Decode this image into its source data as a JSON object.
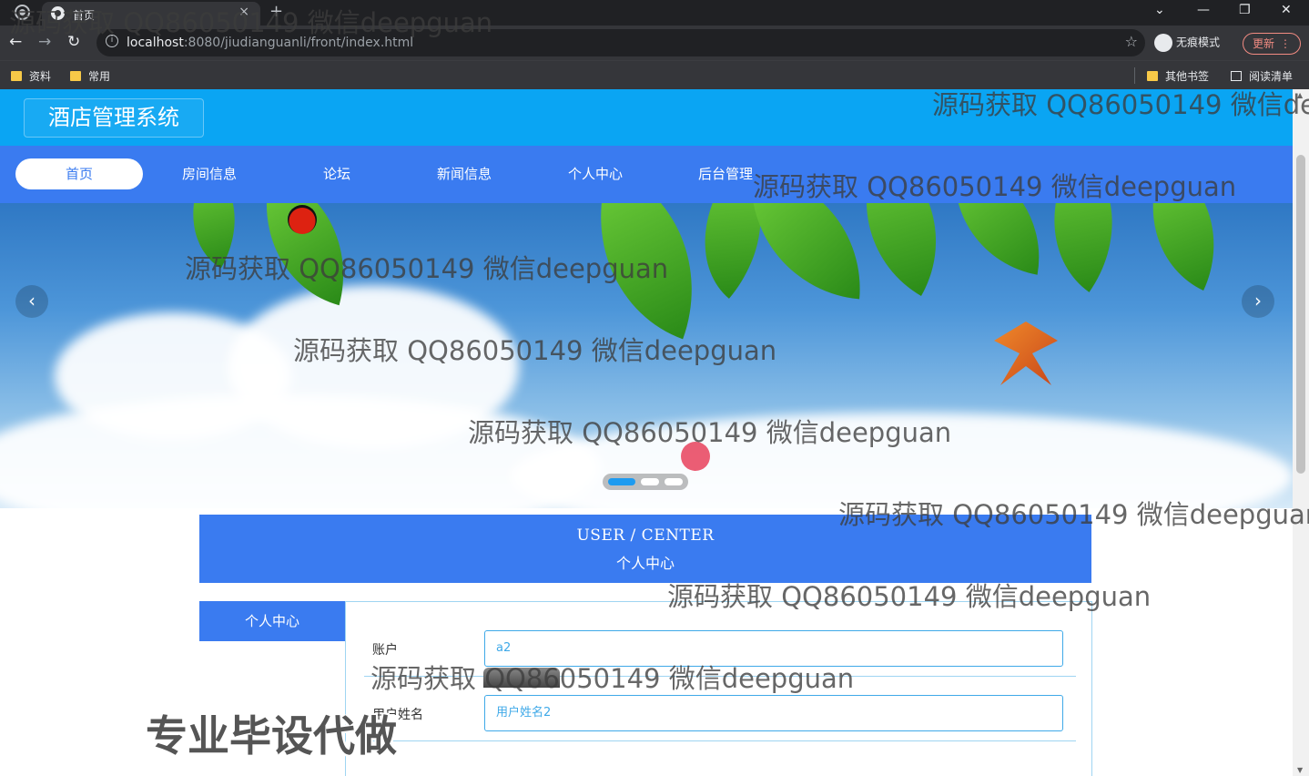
{
  "browser": {
    "tab_title": "首页",
    "tab_close": "×",
    "new_tab": "+",
    "url_host": "localhost",
    "url_rest": ":8080/jiudianguanli/front/index.html",
    "incognito_label": "无痕模式",
    "update_label": "更新",
    "update_menu": "⋮",
    "bookmarks": [
      {
        "label": "资料"
      },
      {
        "label": "常用"
      }
    ],
    "other_bookmarks": "其他书签",
    "reading_list": "阅读清单",
    "back_icon": "←",
    "forward_icon": "→",
    "reload_icon": "↻",
    "star_icon": "☆",
    "info_icon": "i",
    "win_dropdown": "⌄",
    "win_minimize": "—",
    "win_restore": "❐",
    "win_close": "✕"
  },
  "site": {
    "title": "酒店管理系统",
    "nav": [
      {
        "label": "首页",
        "active": true
      },
      {
        "label": "房间信息",
        "active": false
      },
      {
        "label": "论坛",
        "active": false
      },
      {
        "label": "新闻信息",
        "active": false
      },
      {
        "label": "个人中心",
        "active": false
      },
      {
        "label": "后台管理",
        "active": false
      }
    ],
    "carousel": {
      "prev_icon": "‹",
      "next_icon": "›",
      "slide_count": 3,
      "active_index": 0
    },
    "user_center": {
      "title_en": "USER / CENTER",
      "title_zh": "个人中心",
      "side_menu": "个人中心",
      "fields": [
        {
          "label": "账户",
          "value": "a2"
        },
        {
          "label": "用户姓名",
          "value": "用户姓名2"
        }
      ]
    }
  },
  "watermark": {
    "text": "源码获取 QQ86050149 微信deepguan",
    "big": "专业毕设代做"
  },
  "colors": {
    "header_bg": "#0aa5f3",
    "nav_bg": "#3a7bf0",
    "input_border": "#3fa9e8"
  }
}
